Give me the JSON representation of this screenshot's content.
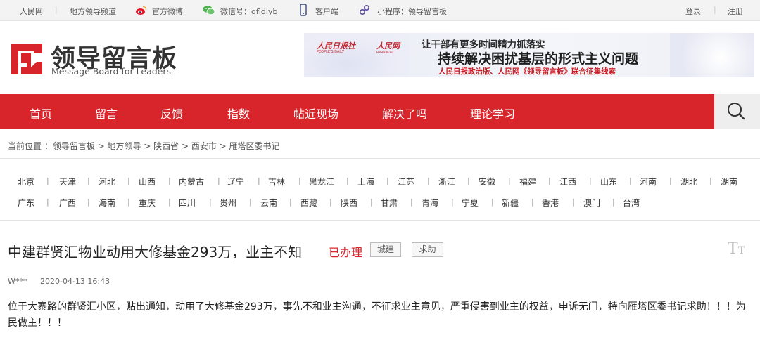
{
  "topbar": {
    "people_net": "人民网",
    "local_channel": "地方领导频道",
    "weibo": "官方微博",
    "wechat": "微信号：dfldlyb",
    "client": "客户端",
    "miniprogram": "小程序：领导留言板",
    "login": "登录",
    "register": "注册",
    "separator": "|"
  },
  "logo": {
    "cn": "领导留言板",
    "en": "Message Board for Leaders"
  },
  "banner": {
    "brand1": "人民日报社",
    "brand1_sub": "PEOPLE'S DAILY",
    "brand2": "人民网",
    "brand2_sub": "people.cn",
    "line1": "让干部有更多时间精力抓落实",
    "line2": "持续解决困扰基层的形式主义问题",
    "line3": "人民日报政治版、人民网《领导留言板》联合征集线索"
  },
  "nav": [
    "首页",
    "留言",
    "反馈",
    "指数",
    "帖近现场",
    "解决了吗",
    "理论学习"
  ],
  "breadcrumb": "当前位置 ：领导留言板 > 地方领导 > 陕西省 > 西安市 > 雁塔区委书记",
  "provinces_row1": [
    "北京",
    "天津",
    "河北",
    "山西",
    "内蒙古",
    "辽宁",
    "吉林",
    "黑龙江",
    "上海",
    "江苏",
    "浙江",
    "安徽",
    "福建",
    "江西",
    "山东",
    "河南",
    "湖北",
    "湖南"
  ],
  "provinces_row2": [
    "广东",
    "广西",
    "海南",
    "重庆",
    "四川",
    "贵州",
    "云南",
    "西藏",
    "陕西",
    "甘肃",
    "青海",
    "宁夏",
    "新疆",
    "香港",
    "澳门",
    "台湾"
  ],
  "message": {
    "title": "中建群贤汇物业动用大修基金293万，业主不知",
    "status": "已办理",
    "tags": [
      "城建",
      "求助"
    ],
    "author": "W***",
    "time": "2020-04-13 16:43",
    "content": "位于大寨路的群贤汇小区，贴出通知，动用了大修基金293万，事先不和业主沟通，不征求业主意见，严重侵害到业主的权益，申诉无门，特向雁塔区委书记求助！！！为民做主！！！"
  },
  "colors": {
    "brand_red": "#d7252b",
    "topbar_bg": "#f3f3f3",
    "search_bg": "#eeeeee"
  },
  "icons": [
    "weibo-icon",
    "wechat-icon",
    "phone-icon",
    "miniprogram-icon",
    "search-icon",
    "font-size-icon"
  ]
}
